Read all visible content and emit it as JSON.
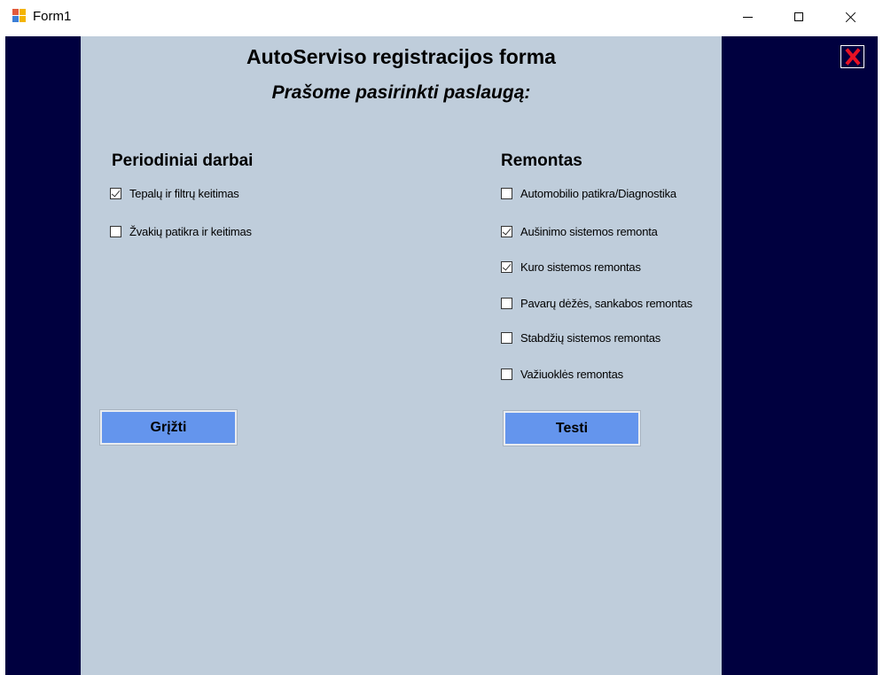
{
  "window": {
    "title": "Form1"
  },
  "form": {
    "title": "AutoServiso registracijos forma",
    "subtitle": "Prašome pasirinkti paslaugą:"
  },
  "periodic": {
    "title": "Periodiniai darbai",
    "items": [
      {
        "label": "Tepalų ir filtrų keitimas",
        "checked": true
      },
      {
        "label": "Žvakių patikra ir keitimas",
        "checked": false
      }
    ]
  },
  "repair": {
    "title": "Remontas",
    "items": [
      {
        "label": "Automobilio patikra/Diagnostika",
        "checked": false
      },
      {
        "label": "Aušinimo sistemos remonta",
        "checked": true
      },
      {
        "label": "Kuro sistemos remontas",
        "checked": true
      },
      {
        "label": "Pavarų dėžės, sankabos remontas",
        "checked": false
      },
      {
        "label": "Stabdžių sistemos remontas",
        "checked": false
      },
      {
        "label": "Važiuoklės remontas",
        "checked": false
      }
    ]
  },
  "buttons": {
    "back_label": "Grįžti",
    "continue_label": "Testi"
  },
  "colors": {
    "background": "#00003f",
    "panel": "#bfcddb",
    "button": "#6495ed",
    "exit": "#e81123"
  },
  "icons": {
    "app": "app-icon",
    "exit": "close-icon"
  }
}
